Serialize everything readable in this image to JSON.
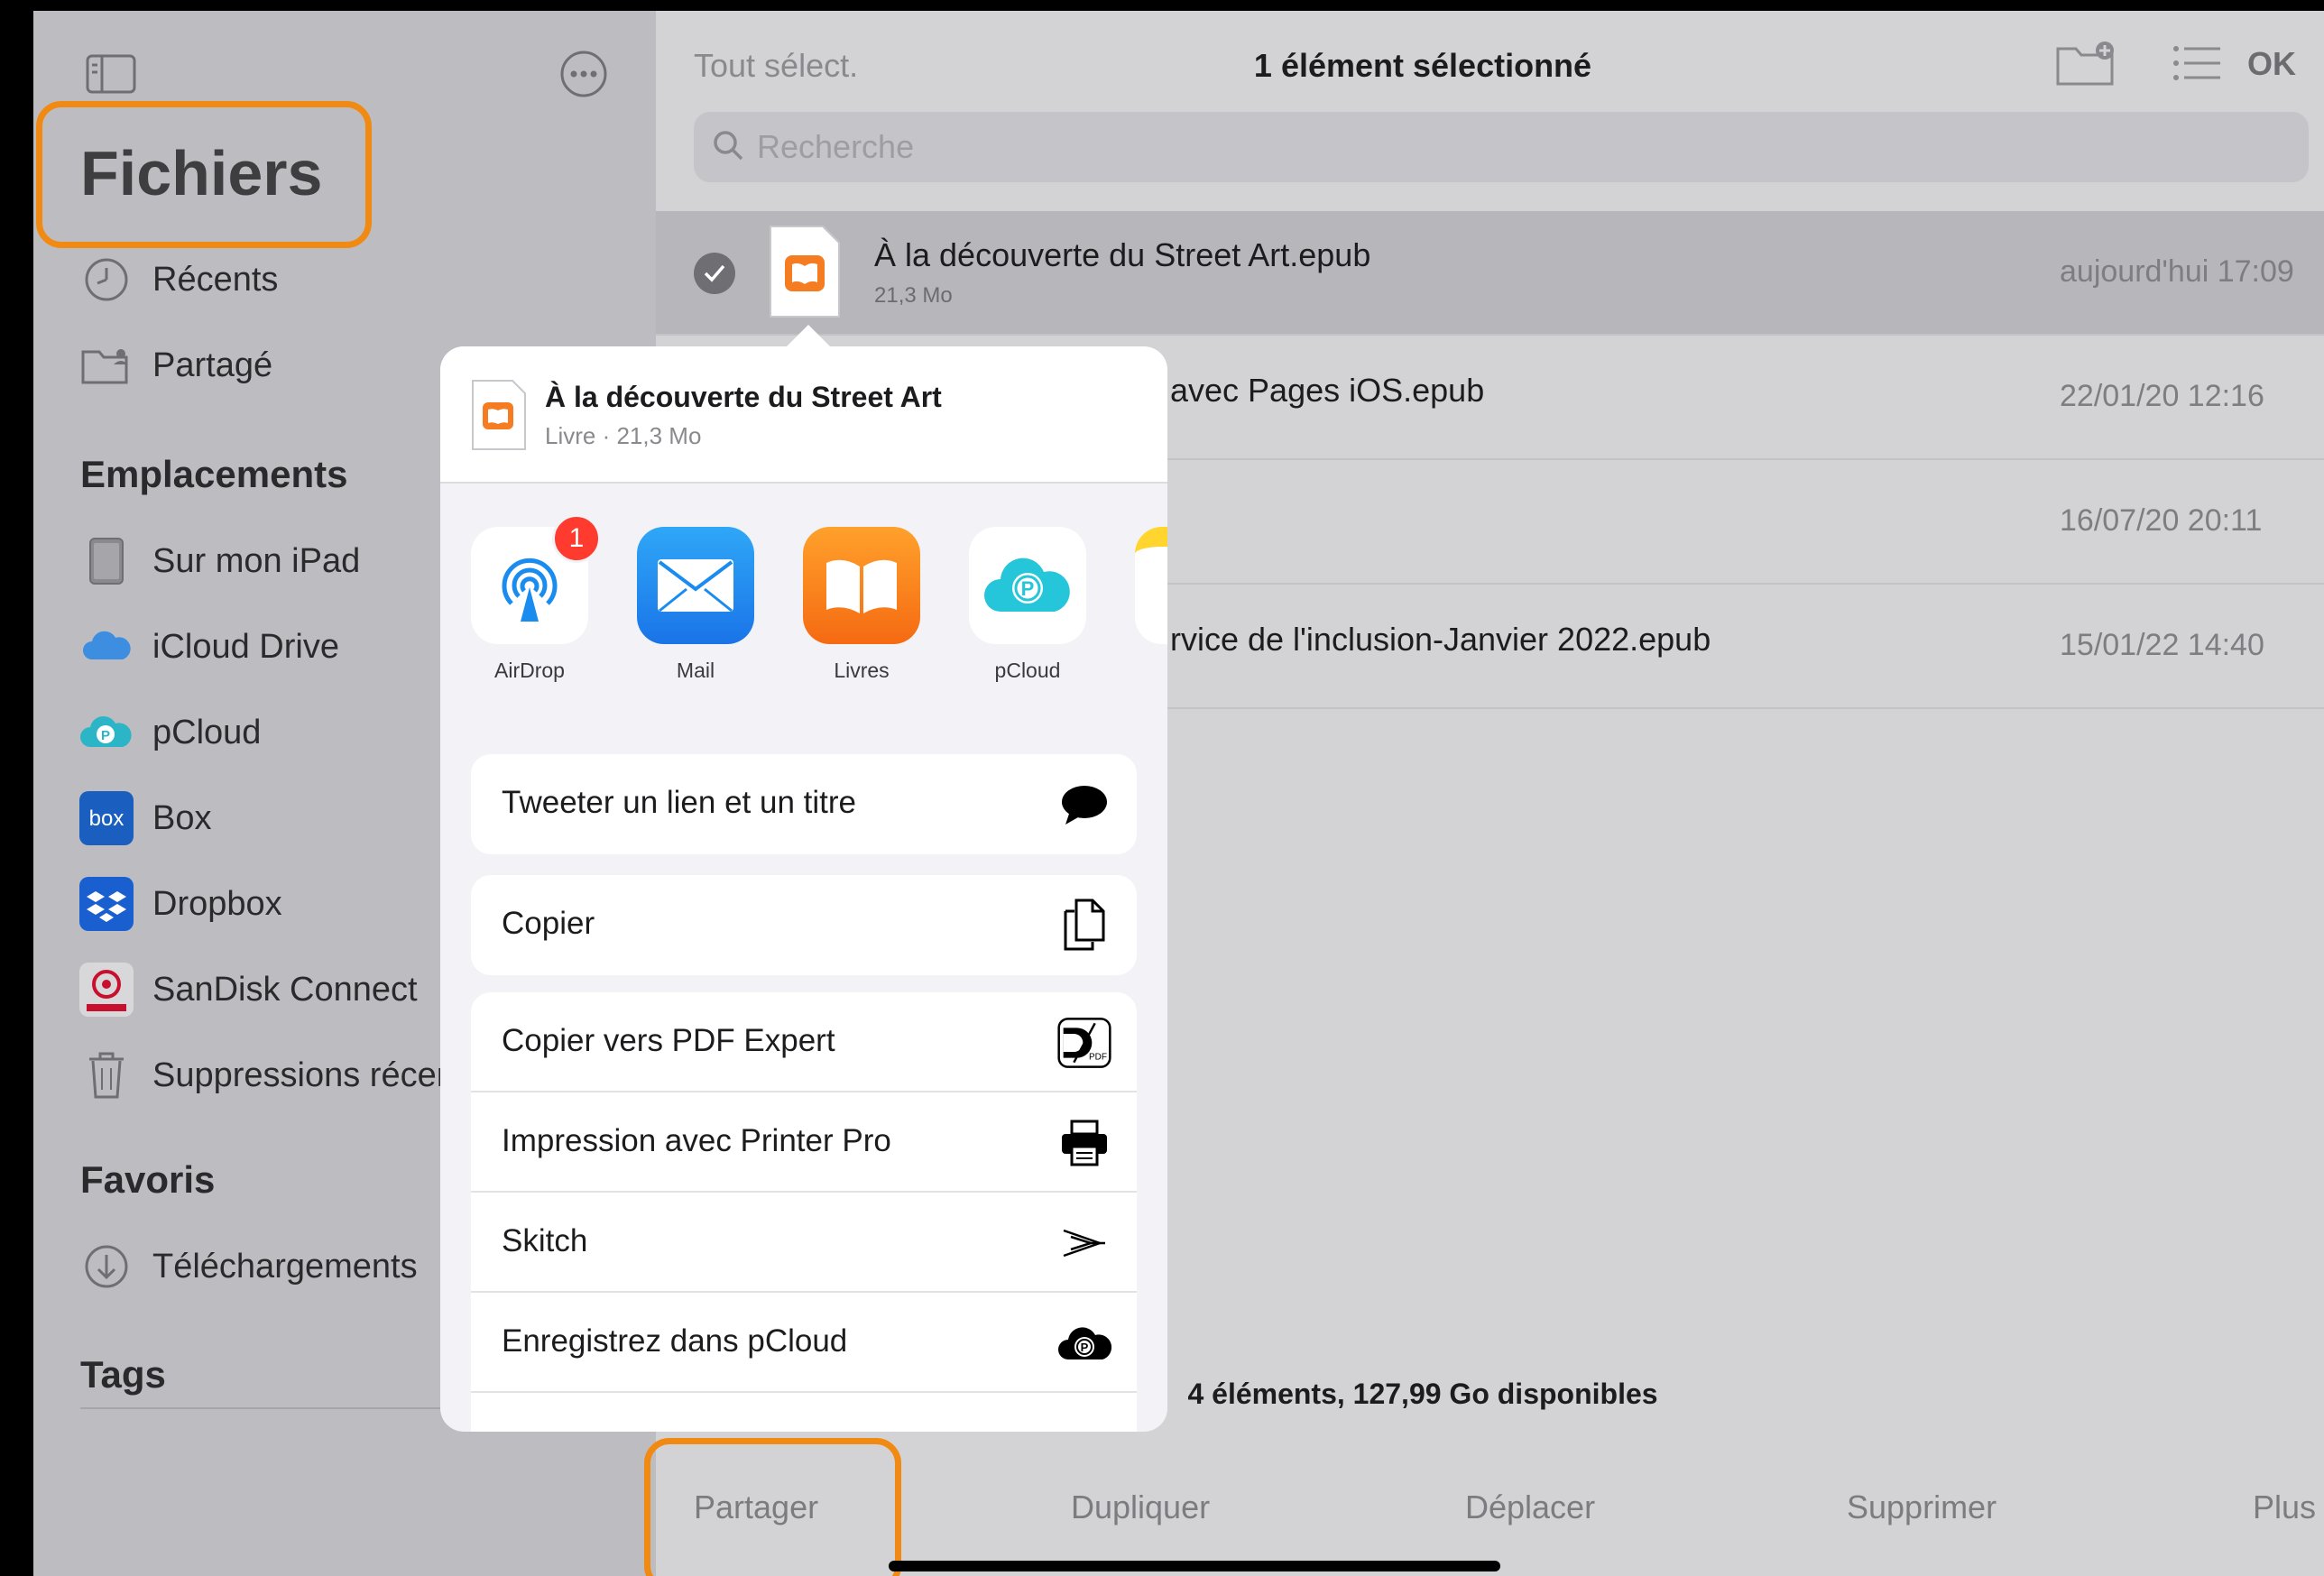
{
  "sidebar": {
    "title": "Fichiers",
    "recents": "Récents",
    "shared": "Partagé",
    "locations_header": "Emplacements",
    "locations": [
      {
        "label": "Sur mon iPad",
        "icon": "ipad-icon"
      },
      {
        "label": "iCloud Drive",
        "icon": "icloud-icon"
      },
      {
        "label": "pCloud",
        "icon": "pcloud-icon"
      },
      {
        "label": "Box",
        "icon": "box-icon"
      },
      {
        "label": "Dropbox",
        "icon": "dropbox-icon"
      },
      {
        "label": "SanDisk Connect",
        "icon": "sandisk-icon"
      },
      {
        "label": "Suppressions récer",
        "icon": "trash-icon"
      }
    ],
    "favorites_header": "Favoris",
    "favorites": [
      {
        "label": "Téléchargements",
        "icon": "download-icon"
      }
    ],
    "tags_header": "Tags"
  },
  "header": {
    "select_all": "Tout sélect.",
    "title": "1 élément sélectionné",
    "ok": "OK"
  },
  "search": {
    "placeholder": "Recherche"
  },
  "files": [
    {
      "name": "À la découverte du Street Art.epub",
      "size": "21,3 Mo",
      "date": "aujourd'hui 17:09",
      "selected": true
    },
    {
      "name": "avec Pages iOS.epub",
      "size": "",
      "date": "22/01/20 12:16",
      "selected": false
    },
    {
      "name": "",
      "size": "",
      "date": "16/07/20 20:11",
      "selected": false
    },
    {
      "name": "rvice de l'inclusion-Janvier 2022.epub",
      "size": "",
      "date": "15/01/22 14:40",
      "selected": false
    }
  ],
  "footer": {
    "info": "4 éléments, 127,99 Go disponibles"
  },
  "toolbar": {
    "share": "Partager",
    "duplicate": "Dupliquer",
    "move": "Déplacer",
    "delete": "Supprimer",
    "more": "Plus"
  },
  "share_sheet": {
    "title": "À la découverte du Street Art",
    "subtitle": "Livre · 21,3 Mo",
    "apps": [
      {
        "label": "AirDrop",
        "badge": "1"
      },
      {
        "label": "Mail"
      },
      {
        "label": "Livres"
      },
      {
        "label": "pCloud"
      }
    ],
    "actions": {
      "tweet": "Tweeter un lien et un titre",
      "copy": "Copier",
      "copy_pdf": "Copier vers PDF Expert",
      "print": "Impression avec Printer Pro",
      "skitch": "Skitch",
      "save_pcloud": "Enregistrez dans pCloud"
    }
  },
  "colors": {
    "highlight": "#f08a12",
    "books_orange": "#f7931e",
    "mail_blue": "#1a8cf0",
    "pcloud_teal": "#26c6da"
  }
}
